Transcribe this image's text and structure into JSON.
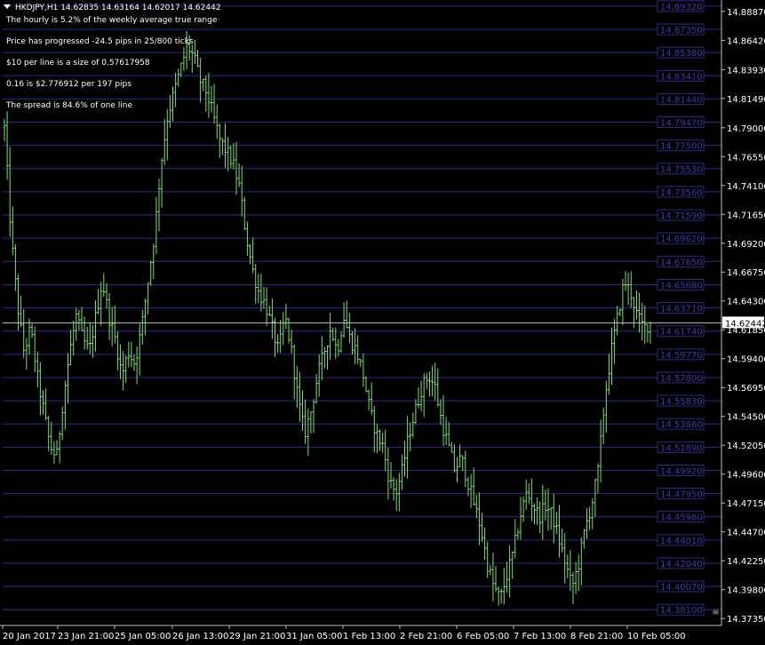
{
  "header": {
    "symbol_line": "HKDJPY,H1  14.62835 14.63164 14.62017 14.62442"
  },
  "info_lines": [
    "The hourly is 5.2% of the weekly average true range",
    "Price has progressed  -24.5  pips in 25/800 ticks",
    "$10 per line is a size of 0.57617958",
    "0.16 is $2.776912 per 197 pips",
    "The spread is 84.6% of one line"
  ],
  "colors": {
    "background": "#000000",
    "candle": "#7ddc6e",
    "axis": "#c0c0c0",
    "grid_line": "#2a2a8c",
    "grid_label": "#3a3aa8",
    "current_line": "#c0c0c0",
    "text": "#ffffff"
  },
  "chart_data": {
    "type": "candlestick",
    "symbol": "HKDJPY",
    "timeframe": "H1",
    "ohlc_last": {
      "open": 14.62835,
      "high": 14.63164,
      "low": 14.62017,
      "close": 14.62442
    },
    "current_price": "14.62442",
    "ylim": [
      14.3676,
      14.8969
    ],
    "y_axis_ticks": [
      "14.88870",
      "14.86420",
      "14.83930",
      "14.81490",
      "14.79000",
      "14.76550",
      "14.74100",
      "14.71650",
      "14.69200",
      "14.66750",
      "14.64300",
      "14.61850",
      "14.59400",
      "14.56950",
      "14.54500",
      "14.52050",
      "14.49600",
      "14.47150",
      "14.44700",
      "14.42250",
      "14.39800",
      "14.37350"
    ],
    "grid_levels": [
      "14.89320",
      "14.87350",
      "14.85380",
      "14.83410",
      "14.81440",
      "14.79470",
      "14.77500",
      "14.75530",
      "14.73560",
      "14.71590",
      "14.69620",
      "14.67650",
      "14.65680",
      "14.63710",
      "14.61740",
      "14.59770",
      "14.57800",
      "14.55830",
      "14.53860",
      "14.51890",
      "14.49920",
      "14.47950",
      "14.45980",
      "14.44010",
      "14.42040",
      "14.40070",
      "14.38100"
    ],
    "x_axis_labels": [
      "20 Jan 2017",
      "23 Jan 21:00",
      "25 Jan 05:00",
      "26 Jan 13:00",
      "29 Jan 21:00",
      "31 Jan 05:00",
      "1 Feb 13:00",
      "2 Feb 21:00",
      "6 Feb 05:00",
      "7 Feb 13:00",
      "8 Feb 21:00",
      "10 Feb 05:00"
    ],
    "close_path": [
      [
        0,
        14.79
      ],
      [
        1,
        14.7
      ],
      [
        2,
        14.64
      ],
      [
        3,
        14.6
      ],
      [
        4,
        14.62
      ],
      [
        5,
        14.58
      ],
      [
        6,
        14.55
      ],
      [
        7,
        14.52
      ],
      [
        8,
        14.51
      ],
      [
        9,
        14.56
      ],
      [
        10,
        14.6
      ],
      [
        11,
        14.63
      ],
      [
        12,
        14.61
      ],
      [
        13,
        14.6
      ],
      [
        14,
        14.63
      ],
      [
        15,
        14.66
      ],
      [
        16,
        14.63
      ],
      [
        17,
        14.61
      ],
      [
        18,
        14.58
      ],
      [
        19,
        14.6
      ],
      [
        20,
        14.59
      ],
      [
        21,
        14.62
      ],
      [
        22,
        14.66
      ],
      [
        23,
        14.7
      ],
      [
        24,
        14.76
      ],
      [
        25,
        14.8
      ],
      [
        26,
        14.82
      ],
      [
        27,
        14.84
      ],
      [
        28,
        14.86
      ],
      [
        29,
        14.85
      ],
      [
        30,
        14.83
      ],
      [
        31,
        14.82
      ],
      [
        32,
        14.8
      ],
      [
        33,
        14.78
      ],
      [
        34,
        14.77
      ],
      [
        35,
        14.76
      ],
      [
        36,
        14.74
      ],
      [
        37,
        14.7
      ],
      [
        38,
        14.67
      ],
      [
        39,
        14.65
      ],
      [
        40,
        14.64
      ],
      [
        41,
        14.62
      ],
      [
        42,
        14.6
      ],
      [
        43,
        14.63
      ],
      [
        44,
        14.6
      ],
      [
        45,
        14.56
      ],
      [
        46,
        14.53
      ],
      [
        47,
        14.55
      ],
      [
        48,
        14.58
      ],
      [
        49,
        14.6
      ],
      [
        50,
        14.62
      ],
      [
        51,
        14.6
      ],
      [
        52,
        14.63
      ],
      [
        53,
        14.61
      ],
      [
        54,
        14.6
      ],
      [
        55,
        14.58
      ],
      [
        56,
        14.55
      ],
      [
        57,
        14.53
      ],
      [
        58,
        14.52
      ],
      [
        59,
        14.49
      ],
      [
        60,
        14.48
      ],
      [
        61,
        14.5
      ],
      [
        62,
        14.53
      ],
      [
        63,
        14.55
      ],
      [
        64,
        14.57
      ],
      [
        65,
        14.58
      ],
      [
        66,
        14.57
      ],
      [
        67,
        14.54
      ],
      [
        68,
        14.52
      ],
      [
        69,
        14.5
      ],
      [
        70,
        14.51
      ],
      [
        71,
        14.49
      ],
      [
        72,
        14.47
      ],
      [
        73,
        14.45
      ],
      [
        74,
        14.42
      ],
      [
        75,
        14.4
      ],
      [
        76,
        14.39
      ],
      [
        77,
        14.41
      ],
      [
        78,
        14.43
      ],
      [
        79,
        14.46
      ],
      [
        80,
        14.48
      ],
      [
        81,
        14.47
      ],
      [
        82,
        14.46
      ],
      [
        83,
        14.47
      ],
      [
        84,
        14.46
      ],
      [
        85,
        14.44
      ],
      [
        86,
        14.42
      ],
      [
        87,
        14.4
      ],
      [
        88,
        14.42
      ],
      [
        89,
        14.45
      ],
      [
        90,
        14.47
      ],
      [
        91,
        14.5
      ],
      [
        92,
        14.56
      ],
      [
        93,
        14.6
      ],
      [
        94,
        14.63
      ],
      [
        95,
        14.66
      ],
      [
        96,
        14.65
      ],
      [
        97,
        14.63
      ],
      [
        98,
        14.62
      ],
      [
        99,
        14.624
      ]
    ]
  }
}
